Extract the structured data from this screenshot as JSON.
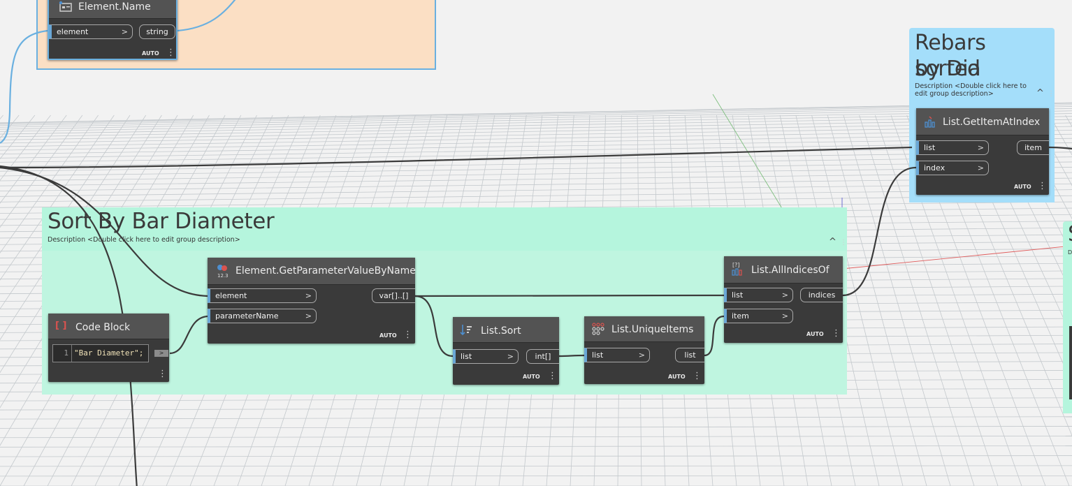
{
  "groups": {
    "top_left": {
      "color": "#fbdfc4",
      "border": "#6ab0e0"
    },
    "sort_by_bar_diameter": {
      "title": "Sort By Bar Diameter",
      "description": "Description <Double click here to edit group description>",
      "color": "#b5f5dd"
    },
    "rebars_sorted": {
      "title_line1": "Rebars sorted",
      "title_line2": "by Dia",
      "description_line1": "Description <Double click here to",
      "description_line2": "edit group description>",
      "color": "#a4defa"
    },
    "right_edge": {
      "title": "S",
      "description": "D",
      "color": "#b5f5dd"
    }
  },
  "nodes": {
    "element_name": {
      "title": "Element.Name",
      "inputs": [
        "element"
      ],
      "outputs": [
        "string"
      ],
      "lacing": "AUTO"
    },
    "list_get_item_at_index": {
      "title": "List.GetItemAtIndex",
      "inputs": [
        "list",
        "index"
      ],
      "outputs": [
        "item"
      ],
      "lacing": "AUTO"
    },
    "element_get_parameter_value_by_name": {
      "title": "Element.GetParameterValueByName",
      "inputs": [
        "element",
        "parameterName"
      ],
      "outputs": [
        "var[]..[]"
      ],
      "lacing": "AUTO",
      "icon_text": "12.3"
    },
    "code_block": {
      "title": "Code Block",
      "line_number": "1",
      "code": "\"Bar Diameter\";",
      "out_marker": ">"
    },
    "list_sort": {
      "title": "List.Sort",
      "inputs": [
        "list"
      ],
      "outputs": [
        "int[]"
      ],
      "lacing": "AUTO"
    },
    "list_unique_items": {
      "title": "List.UniqueItems",
      "inputs": [
        "list"
      ],
      "outputs": [
        "list"
      ],
      "lacing": "AUTO"
    },
    "list_all_indices_of": {
      "title": "List.AllIndicesOf",
      "inputs": [
        "list",
        "item"
      ],
      "outputs": [
        "indices"
      ],
      "lacing": "AUTO",
      "icon_text": "[?]"
    }
  },
  "ui": {
    "arrow": ">",
    "kebab": "⋮",
    "collapse": "^",
    "code_icon": "[ ]"
  },
  "colors": {
    "canvas": "#f2f2f2",
    "grid": "#c3c8cc",
    "wire": "#3b3b3b",
    "selected_wire": "#6ab0e0",
    "port_accent": "#6aa7d6",
    "node_body": "#3a3a3a",
    "node_header": "#535353"
  }
}
